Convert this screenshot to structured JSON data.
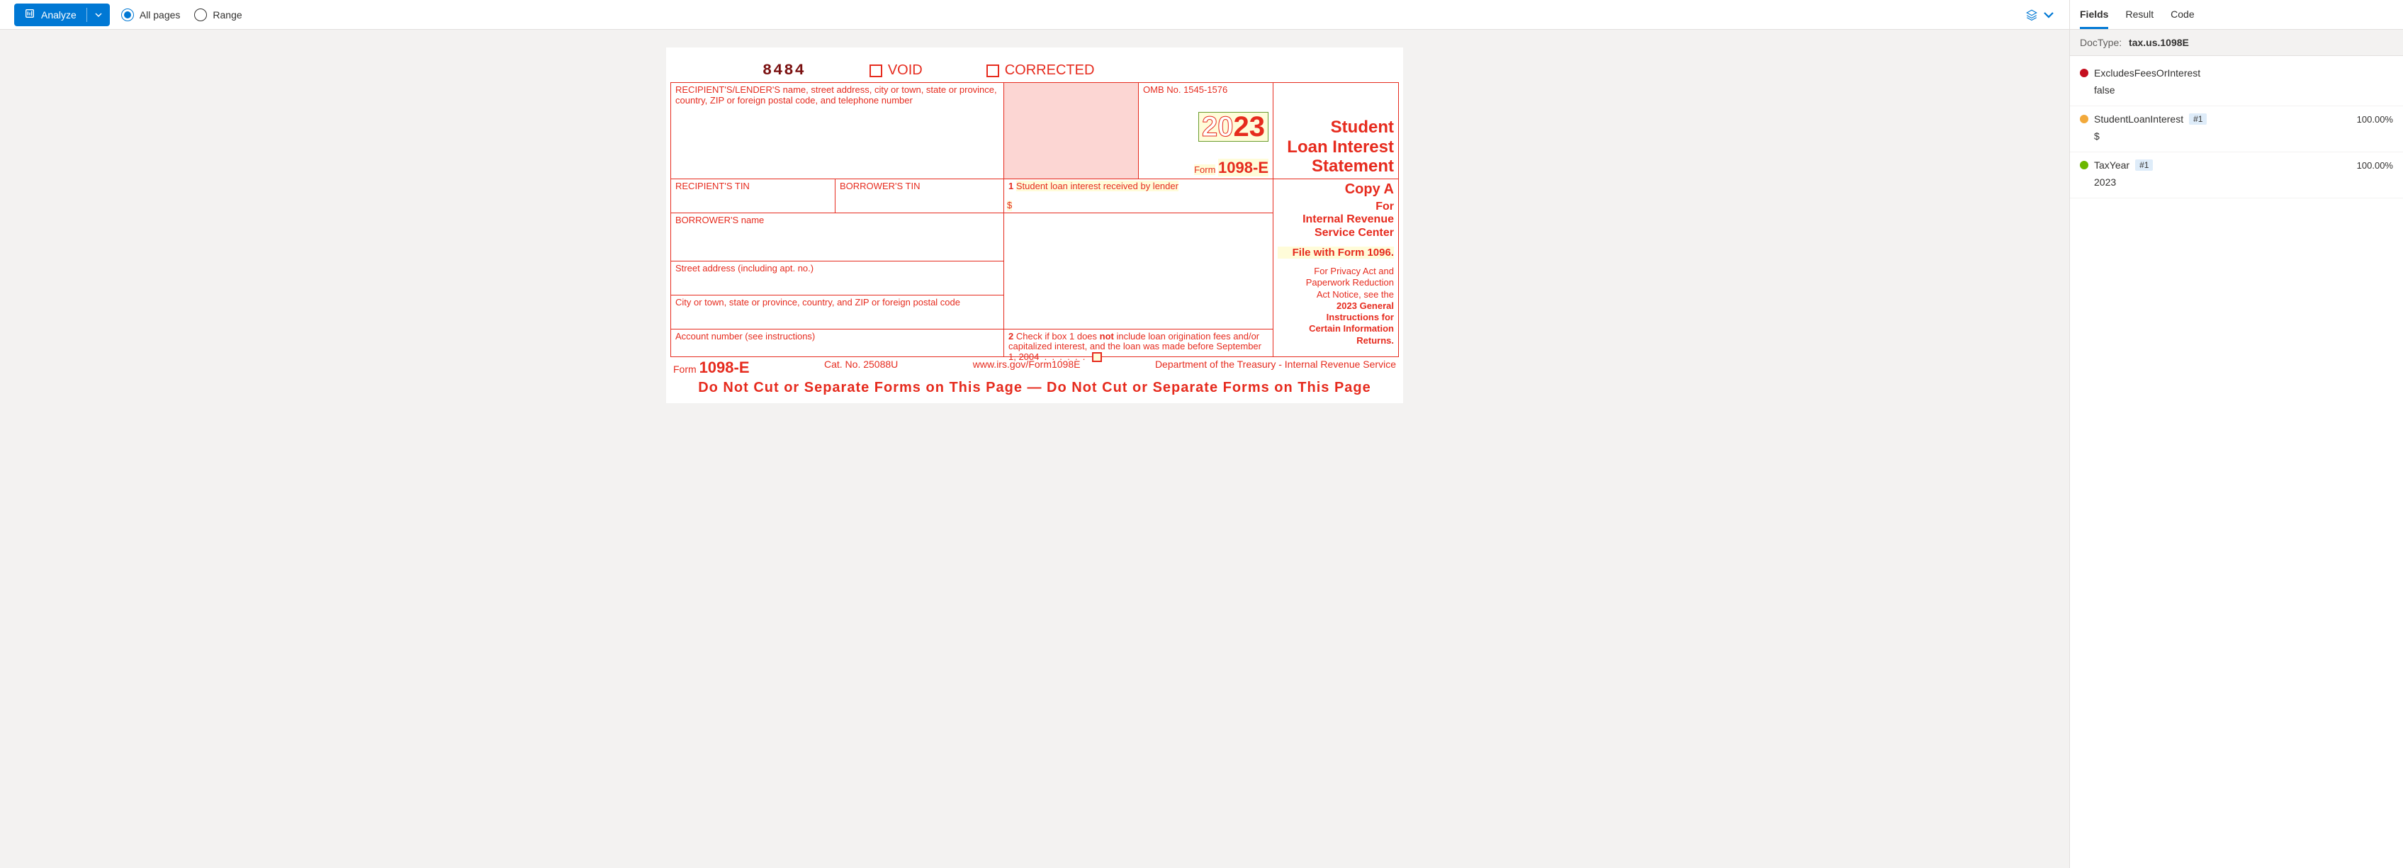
{
  "toolbar": {
    "analyze_label": "Analyze",
    "all_pages_label": "All pages",
    "range_label": "Range",
    "page_mode": "all"
  },
  "right_panel": {
    "tabs": {
      "fields": "Fields",
      "result": "Result",
      "code": "Code",
      "active": "fields"
    },
    "doctype_label": "DocType:",
    "doctype_value": "tax.us.1098E",
    "fields": [
      {
        "name": "ExcludesFeesOrInterest",
        "value": "false",
        "color": "#c50f1f",
        "badge": null,
        "confidence": null
      },
      {
        "name": "StudentLoanInterest",
        "value": "$",
        "color": "#f2a93b",
        "badge": "#1",
        "confidence": "100.00%"
      },
      {
        "name": "TaxYear",
        "value": "2023",
        "color": "#6bb700",
        "badge": "#1",
        "confidence": "100.00%"
      }
    ]
  },
  "doc": {
    "sequence": "8484",
    "void_label": "VOID",
    "corrected_label": "CORRECTED",
    "recipient_header": "RECIPIENT'S/LENDER'S name, street address, city or town, state or province, country, ZIP or foreign postal code, and telephone number",
    "omb": "OMB No. 1545-1576",
    "year_prefix": "20",
    "year_suffix": "23",
    "form_label": "Form",
    "form_no": "1098-E",
    "title_l1": "Student",
    "title_l2": "Loan Interest",
    "title_l3": "Statement",
    "recipient_tin": "RECIPIENT'S TIN",
    "borrower_tin": "BORROWER'S TIN",
    "box1_num": "1",
    "box1_label": "Student loan interest received by lender",
    "box1_dollar": "$",
    "copy_a": "Copy A",
    "for_irs": "For Internal Revenue Service Center",
    "file_with": "File with Form 1096.",
    "privacy": "For Privacy Act and Paperwork Reduction Act Notice, see the 2023 General Instructions for Certain Information Returns.",
    "borrower_name": "BORROWER'S name",
    "street_addr": "Street address (including apt. no.)",
    "city_line": "City or town, state or province, country, and ZIP or foreign postal code",
    "account_no": "Account number (see instructions)",
    "box2_num": "2",
    "box2_a": "Check if box 1 does ",
    "box2_not": "not",
    "box2_b": " include loan origination fees and/or capitalized interest, and the loan was made before September 1, 2004",
    "footer_form": "Form",
    "footer_form_no": "1098-E",
    "footer_cat": "Cat. No. 25088U",
    "footer_url": "www.irs.gov/Form1098E",
    "footer_dept": "Department of the Treasury - Internal Revenue Service",
    "do_not_cut": "Do Not Cut or Separate Forms on This Page — Do Not Cut or Separate Forms on This Page"
  }
}
